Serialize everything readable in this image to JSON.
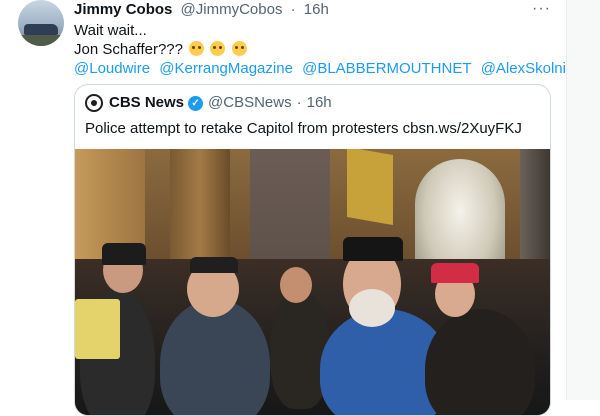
{
  "tweet": {
    "author_name": "Jimmy Cobos",
    "author_handle": "@JimmyCobos",
    "time_sep": "·",
    "time": "16h",
    "more_label": "···",
    "lines": [
      "Wait wait...",
      "Jon Schaffer???"
    ],
    "emojis": [
      "thinking-face",
      "thinking-face",
      "thinking-face"
    ],
    "mentions": [
      "@Loudwire",
      "@KerrangMagazine",
      "@BLABBERMOUTHNET",
      "@AlexSkolnick"
    ]
  },
  "quoted": {
    "name": "CBS News",
    "handle": "@CBSNews",
    "time_sep": "·",
    "time": "16h",
    "text": "Police attempt to retake Capitol from protesters cbsn.ws/2XuyFKJ",
    "verified_icon": "✓"
  },
  "colors": {
    "link": "#1d9bf0",
    "secondary_text": "#536471",
    "border": "#cfd9de"
  }
}
